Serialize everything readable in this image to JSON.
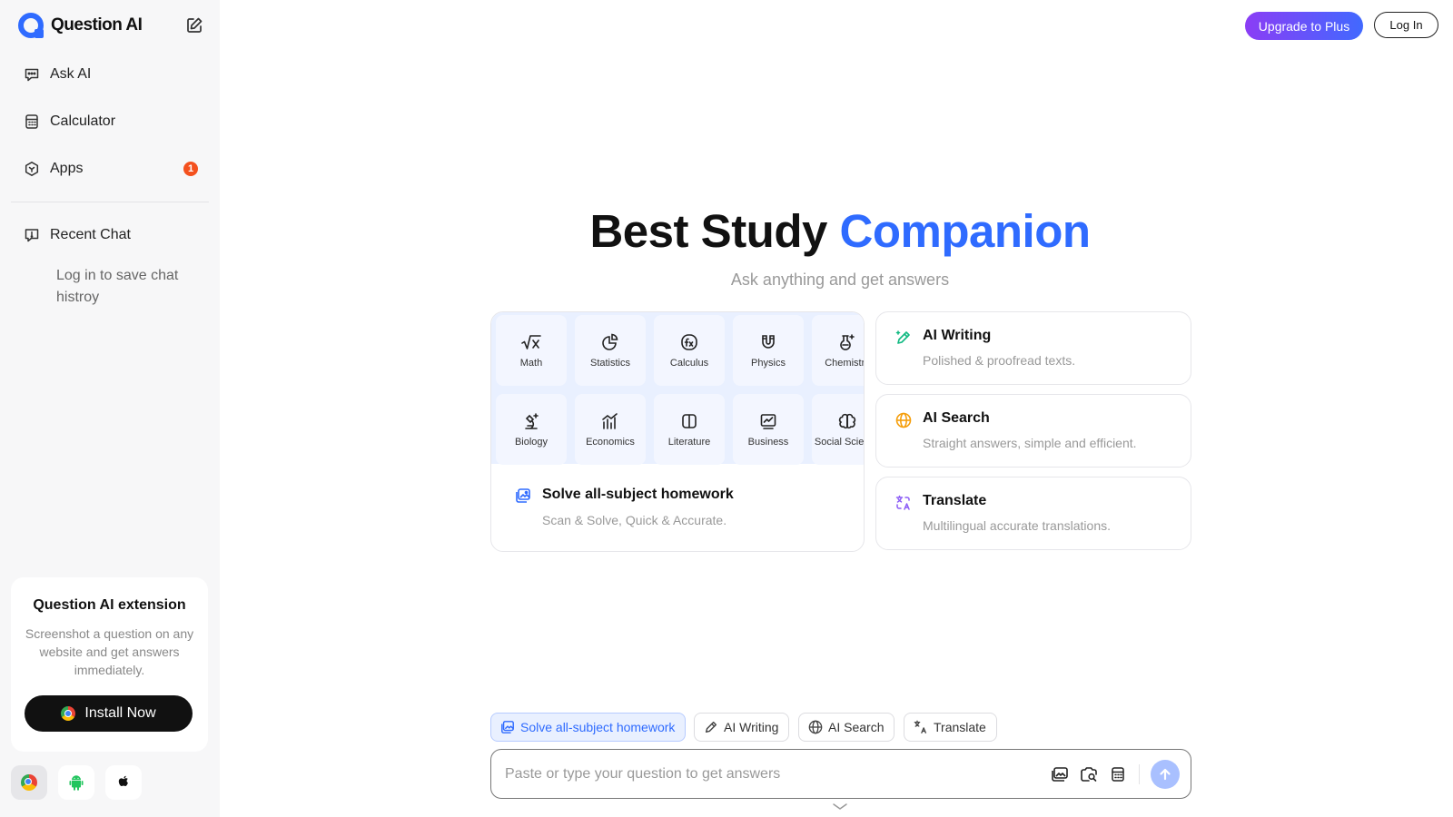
{
  "brand": {
    "name": "Question AI"
  },
  "sidebar": {
    "items": [
      {
        "label": "Ask AI",
        "icon": "chat-icon"
      },
      {
        "label": "Calculator",
        "icon": "calculator-icon"
      },
      {
        "label": "Apps",
        "icon": "apps-icon",
        "badge": "1"
      }
    ],
    "recent": {
      "label": "Recent Chat",
      "icon": "recent-chat-icon",
      "hint": "Log in to save chat histroy"
    },
    "extension": {
      "title": "Question AI extension",
      "description": "Screenshot a question on any website and get answers immediately.",
      "install_label": "Install Now"
    },
    "platforms": [
      "chrome-icon",
      "android-icon",
      "apple-icon"
    ]
  },
  "header": {
    "upgrade_label": "Upgrade to Plus",
    "login_label": "Log In"
  },
  "hero": {
    "title_plain": "Best Study ",
    "title_accent": "Companion",
    "subtitle": "Ask anything and get answers"
  },
  "homework": {
    "subjects": [
      "Math",
      "Statistics",
      "Calculus",
      "Physics",
      "Chemistry",
      "Biology",
      "Economics",
      "Literature",
      "Business",
      "Social Science"
    ],
    "title": "Solve all-subject homework",
    "description": "Scan & Solve, Quick & Accurate."
  },
  "features": [
    {
      "title": "AI Writing",
      "description": "Polished & proofread texts.",
      "icon": "ai-writing-icon",
      "color": "#10b981"
    },
    {
      "title": "AI Search",
      "description": "Straight answers, simple and efficient.",
      "icon": "globe-icon",
      "color": "#f59e0b"
    },
    {
      "title": "Translate",
      "description": "Multilingual accurate translations.",
      "icon": "translate-icon",
      "color": "#8b5cf6"
    }
  ],
  "modes": [
    {
      "label": "Solve all-subject homework",
      "active": true
    },
    {
      "label": "AI Writing",
      "active": false
    },
    {
      "label": "AI Search",
      "active": false
    },
    {
      "label": "Translate",
      "active": false
    }
  ],
  "composer": {
    "placeholder": "Paste or type your question to get answers"
  },
  "colors": {
    "accent": "#2f6bff",
    "badge": "#f4511e",
    "upgrade_from": "#8b3df5",
    "upgrade_to": "#4169ff"
  }
}
